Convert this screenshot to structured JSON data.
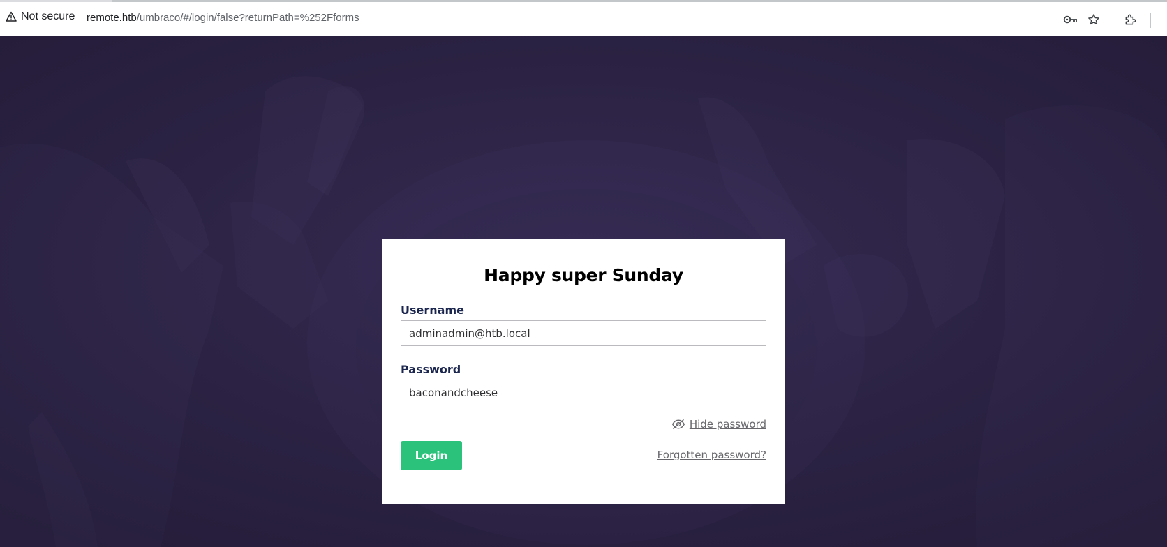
{
  "browser": {
    "security_label": "Not secure",
    "url_host": "remote.htb",
    "url_path": "/umbraco/#/login/false?returnPath=%252Fforms",
    "icons": [
      "warning-icon",
      "key-icon",
      "star-icon",
      "extensions-icon"
    ]
  },
  "login": {
    "greeting": "Happy super Sunday",
    "username_label": "Username",
    "username_value": "adminadmin@htb.local",
    "password_label": "Password",
    "password_value": "baconandcheese",
    "hide_password_label": "Hide password",
    "login_button": "Login",
    "forgot_password": "Forgotten password?"
  },
  "colors": {
    "background": "#2c2343",
    "card": "#ffffff",
    "login_button": "#2bc37c",
    "link": "#68676b"
  }
}
